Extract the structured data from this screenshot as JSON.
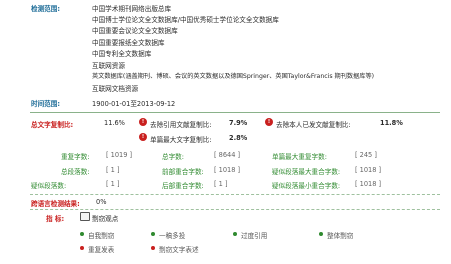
{
  "scope": {
    "label": "检测范围:",
    "items": [
      "中国学术期刊网络出版总库",
      "中国博士学位论文全文数据库/中国优秀硕士学位论文全文数据库",
      "中国重要会议论文全文数据库",
      "中国重要报纸全文数据库",
      "中国专利全文数据库",
      "互联网资源",
      "英文数据库(涵盖期刊、博硕、会议的英文数据以及德国Springer、英国Taylor&Francis 期刊数据库等)",
      "互联网文档资源"
    ]
  },
  "time": {
    "label": "时间范围:",
    "value": "1900-01-01至2013-09-12"
  },
  "overall": {
    "total_label": "总文字复制比:",
    "total_value": "11.6%",
    "exclude_ref_label": "去除引用文献复制比:",
    "exclude_ref_value": "7.9%",
    "exclude_self_label": "去除本人已发文献复制比:",
    "exclude_self_value": "11.8%",
    "max_single_label": "单篇最大文字复制比:",
    "max_single_value": "2.8%"
  },
  "stats": [
    [
      {
        "label": "重复字数:",
        "value": "[ 1019 ]"
      },
      {
        "label": "总字数:",
        "value": "[ 8644 ]"
      },
      {
        "label": "单篇最大重复字数:",
        "value": "[ 245 ]"
      }
    ],
    [
      {
        "label": "总段落数:",
        "value": "[ 1 ]"
      },
      {
        "label": "前部重合字数:",
        "value": "[ 1018 ]"
      },
      {
        "label": "疑似段落最大重合字数:",
        "value": "[ 1018 ]"
      }
    ],
    [
      {
        "label": "疑似段落数:",
        "value": "[ 1 ]"
      },
      {
        "label": "后部重合字数:",
        "value": "[ 1 ]"
      },
      {
        "label": "疑似段落最小重合字数:",
        "value": "[ 1018 ]"
      }
    ]
  ],
  "cross_check": {
    "label": "跨语言检测结果:",
    "value": "0%"
  },
  "indicators": {
    "label": "指    标:",
    "legend": "剽窃观点",
    "items": [
      {
        "label": "自我剽窃",
        "color": "#2f8a2f"
      },
      {
        "label": "一稿多投",
        "color": "#2f8a2f"
      },
      {
        "label": "过度引用",
        "color": "#2f8a2f"
      },
      {
        "label": "整体剽窃",
        "color": "#2f8a2f"
      },
      {
        "label": "重复发表",
        "color": "#c9201f"
      },
      {
        "label": "剽窃文字表述",
        "color": "#c9201f"
      }
    ]
  },
  "icon_names": [
    "exclamation-icon",
    "exclamation-icon",
    "exclamation-icon",
    "legend-box-icon"
  ]
}
